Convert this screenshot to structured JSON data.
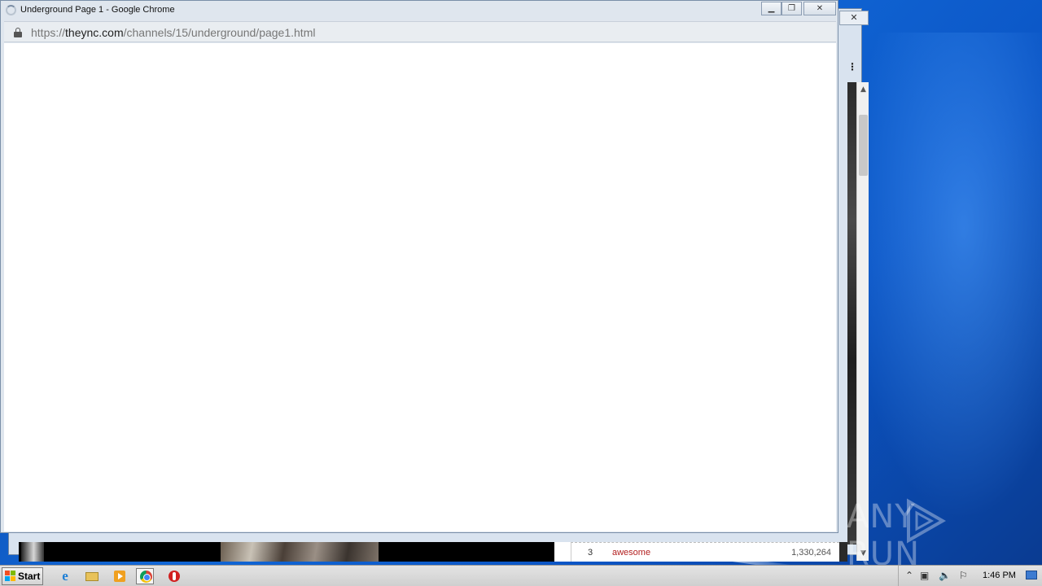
{
  "browser": {
    "title": "Underground Page 1 - Google Chrome",
    "url_scheme": "https://",
    "url_host": "theync.com",
    "url_path": "/channels/15/underground/page1.html",
    "buttons": {
      "minimize": "▁",
      "maximize": "❐",
      "close": "✕"
    }
  },
  "background_window": {
    "close": "✕",
    "menu": "⋮",
    "scroll_up": "▲",
    "scroll_down": "▼",
    "list_row": {
      "rank": "3",
      "title": "awesome",
      "views": "1,330,264"
    }
  },
  "taskbar": {
    "start_label": "Start",
    "clock": "1:46 PM",
    "icons": [
      "internet-explorer-icon",
      "folder-icon",
      "media-player-icon",
      "chrome-icon",
      "opera-icon"
    ],
    "tray_icons": {
      "expand": "⌃",
      "flag": "⚐",
      "volume": "🔈",
      "network": "▣"
    }
  },
  "watermark": {
    "left": "ANY",
    "right": "RUN"
  }
}
